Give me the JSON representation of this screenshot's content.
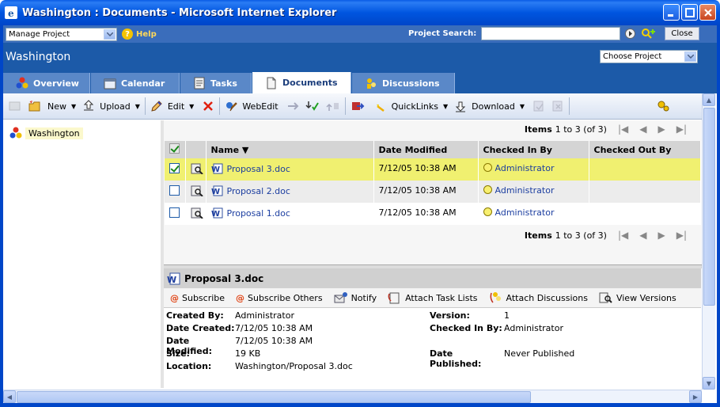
{
  "window": {
    "title": "Washington : Documents - Microsoft Internet Explorer"
  },
  "topbar": {
    "project_select": "Manage Project",
    "help_label": "Help",
    "search_label": "Project Search:",
    "search_value": "",
    "close_label": "Close"
  },
  "project": {
    "name": "Washington",
    "choose_label": "Choose Project"
  },
  "tabs": [
    {
      "label": "Overview",
      "icon": "overview-icon"
    },
    {
      "label": "Calendar",
      "icon": "calendar-icon"
    },
    {
      "label": "Tasks",
      "icon": "tasks-icon"
    },
    {
      "label": "Documents",
      "icon": "documents-icon",
      "active": true
    },
    {
      "label": "Discussions",
      "icon": "discussions-icon"
    }
  ],
  "toolbar": {
    "new_label": "New",
    "upload_label": "Upload",
    "edit_label": "Edit",
    "webedit_label": "WebEdit",
    "quicklinks_label": "QuickLinks",
    "download_label": "Download"
  },
  "tree": {
    "root_label": "Washington"
  },
  "pager": {
    "items_label": "Items",
    "range": "1 to 3 (of 3)"
  },
  "table": {
    "columns": [
      "Name",
      "Date Modified",
      "Checked In By",
      "Checked Out By"
    ],
    "rows": [
      {
        "name": "Proposal 3.doc",
        "modified": "7/12/05 10:38 AM",
        "checked_in_by": "Administrator",
        "checked_out_by": "",
        "selected": true
      },
      {
        "name": "Proposal 2.doc",
        "modified": "7/12/05 10:38 AM",
        "checked_in_by": "Administrator",
        "checked_out_by": "",
        "selected": false
      },
      {
        "name": "Proposal 1.doc",
        "modified": "7/12/05 10:38 AM",
        "checked_in_by": "Administrator",
        "checked_out_by": "",
        "selected": false
      }
    ]
  },
  "details": {
    "title": "Proposal 3.doc",
    "actions": {
      "subscribe": "Subscribe",
      "subscribe_others": "Subscribe Others",
      "notify": "Notify",
      "attach_tasks": "Attach Task Lists",
      "attach_discussions": "Attach Discussions",
      "view_versions": "View Versions"
    },
    "props": {
      "created_by_label": "Created By:",
      "created_by": "Administrator",
      "date_created_label": "Date Created:",
      "date_created": "7/12/05 10:38 AM",
      "date_modified_label": "Date Modified:",
      "date_modified": "7/12/05 10:38 AM",
      "size_label": "Size:",
      "size": "19 KB",
      "location_label": "Location:",
      "location": "Washington/Proposal 3.doc",
      "version_label": "Version:",
      "version": "1",
      "checked_in_label": "Checked In By:",
      "checked_in": "Administrator",
      "published_label": "Date Published:",
      "published": "Never Published"
    }
  }
}
